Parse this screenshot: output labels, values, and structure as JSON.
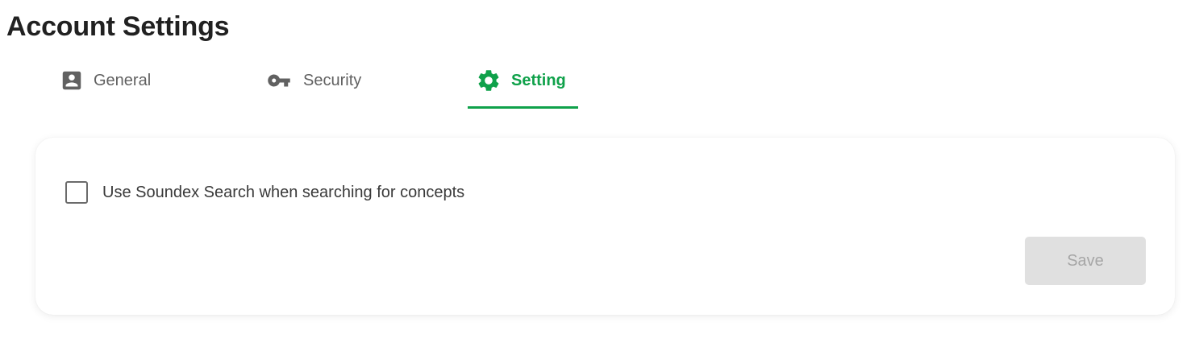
{
  "page": {
    "title": "Account Settings"
  },
  "tabs": [
    {
      "label": "General",
      "icon": "account-box-icon",
      "active": false
    },
    {
      "label": "Security",
      "icon": "key-icon",
      "active": false
    },
    {
      "label": "Setting",
      "icon": "gear-icon",
      "active": true
    }
  ],
  "settings_card": {
    "option": {
      "label": "Use Soundex Search when searching for concepts",
      "checked": false
    },
    "save_label": "Save",
    "save_enabled": false
  },
  "colors": {
    "accent": "#0fa14a",
    "inactive_tab": "#616161",
    "disabled_button_bg": "#e0e0e0",
    "disabled_button_text": "#a6a6a6"
  }
}
